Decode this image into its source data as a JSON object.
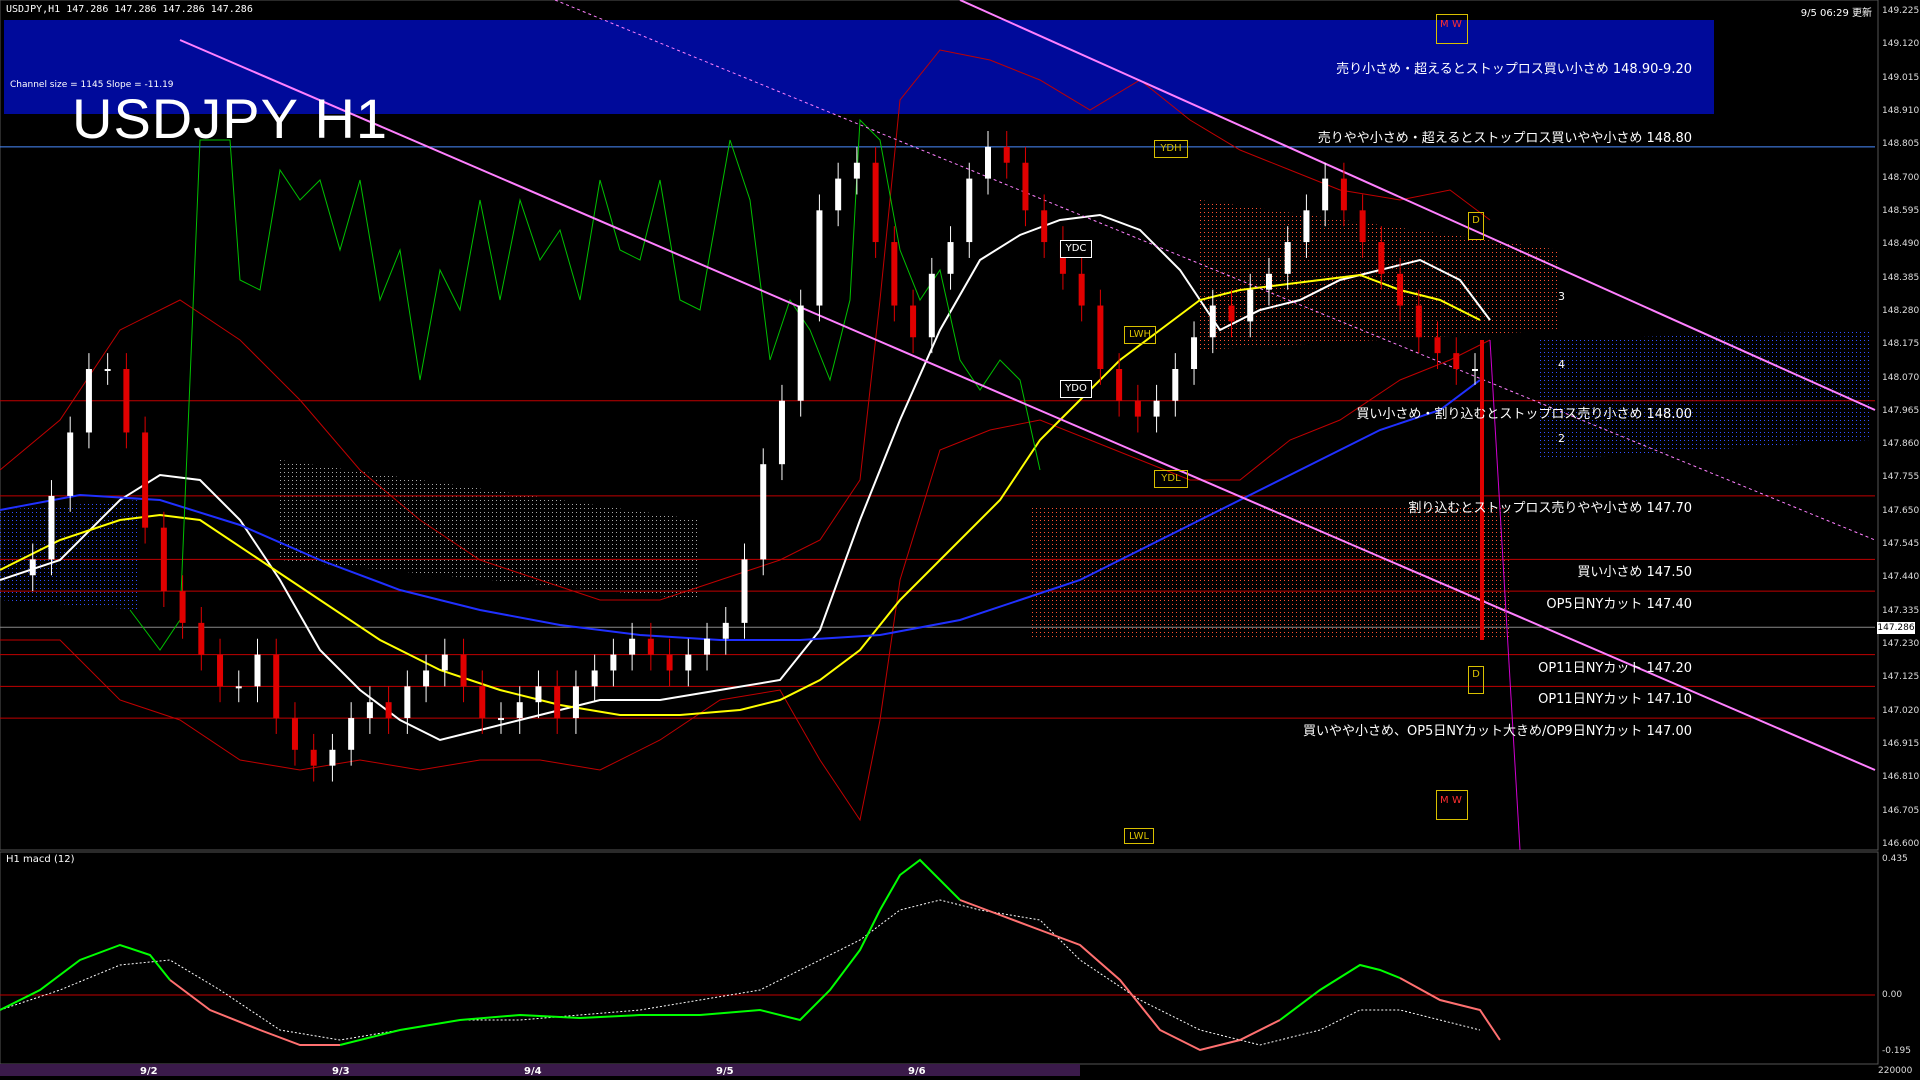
{
  "header": {
    "symbol_line": "USDJPY,H1  147.286 147.286 147.286 147.286",
    "timestamp": "9/5 06:29 更新",
    "channel_info": "Channel size = 1145 Slope = -11.19",
    "title": "USDJPY H1"
  },
  "levels": [
    {
      "price": 148.8,
      "label": "売りやや小さめ・超えるとストップロス買いやや小さめ 148.80",
      "color": "#4a8cff"
    },
    {
      "price": 148.0,
      "label": "買い小さめ・割り込むとストップロス売り小さめ 148.00",
      "color": "#c00000"
    },
    {
      "price": 147.7,
      "label": "割り込むとストップロス売りやや小さめ 147.70",
      "color": "#c00000"
    },
    {
      "price": 147.5,
      "label": "買い小さめ 147.50",
      "color": "#c00000"
    },
    {
      "price": 147.4,
      "label": "OP5日NYカット 147.40",
      "color": "#c00000"
    },
    {
      "price": 147.2,
      "label": "OP11日NYカット 147.20",
      "color": "#c00000"
    },
    {
      "price": 147.1,
      "label": "OP11日NYカット 147.10",
      "color": "#c00000"
    },
    {
      "price": 147.0,
      "label": "買いやや小さめ、OP5日NYカット大きめ/OP9日NYカット 147.00",
      "color": "#c00000"
    }
  ],
  "band": {
    "label": "売り小さめ・超えるとストップロス買い小さめ 148.90-9.20",
    "color": "#0000a0"
  },
  "current_price": "147.286",
  "price_axis": [
    "149.225",
    "149.120",
    "149.015",
    "148.910",
    "148.805",
    "148.700",
    "148.595",
    "148.490",
    "148.385",
    "148.280",
    "148.175",
    "148.070",
    "147.965",
    "147.860",
    "147.755",
    "147.650",
    "147.545",
    "147.440",
    "147.335",
    "147.230",
    "147.125",
    "147.020",
    "146.915",
    "146.810",
    "146.705",
    "146.600"
  ],
  "macd": {
    "label": "H1  macd (12)",
    "axis": [
      "0.435",
      "0.00",
      "-0.195",
      "220000"
    ]
  },
  "date_tabs": [
    "9/2",
    "9/3",
    "9/4",
    "9/5",
    "9/6"
  ],
  "markers": {
    "ydh": "YDH",
    "ydl": "YDL",
    "ydc": "YDC",
    "ydo": "YDO",
    "lwh": "LWH",
    "lwl": "LWL",
    "d": "D",
    "m": "M",
    "w": "W",
    "waves": [
      "3",
      "4",
      "2"
    ]
  },
  "colors": {
    "ichimoku_cloud": "#ff5030",
    "ma_white": "#ffffff",
    "ma_yellow": "#ffff00",
    "ma_blue": "#2030ff",
    "bollinger": "#d00000",
    "lagging": "#00c000",
    "channel": "#ff80ff",
    "macd_up": "#00ff00",
    "macd_down": "#ff7070"
  }
}
